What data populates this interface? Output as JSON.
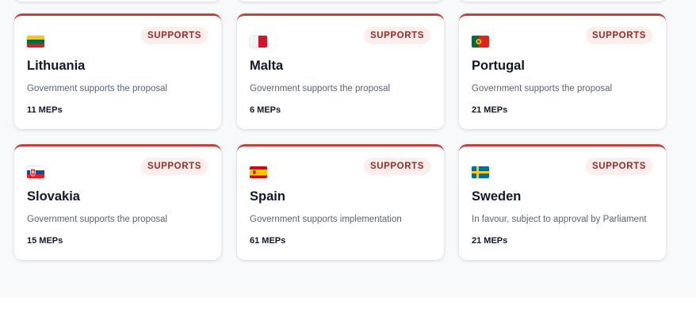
{
  "cards": [
    {
      "country": "Lithuania",
      "badge": "SUPPORTS",
      "description": "Government supports the proposal",
      "meps": "11 MEPs",
      "flag": "lithuania-flag"
    },
    {
      "country": "Malta",
      "badge": "SUPPORTS",
      "description": "Government supports the proposal",
      "meps": "6 MEPs",
      "flag": "malta-flag"
    },
    {
      "country": "Portugal",
      "badge": "SUPPORTS",
      "description": "Government supports the proposal",
      "meps": "21 MEPs",
      "flag": "portugal-flag"
    },
    {
      "country": "Slovakia",
      "badge": "SUPPORTS",
      "description": "Government supports the proposal",
      "meps": "15 MEPs",
      "flag": "slovakia-flag"
    },
    {
      "country": "Spain",
      "badge": "SUPPORTS",
      "description": "Government supports implementation",
      "meps": "61 MEPs",
      "flag": "spain-flag"
    },
    {
      "country": "Sweden",
      "badge": "SUPPORTS",
      "description": "In favour, subject to approval by Parliament",
      "meps": "21 MEPs",
      "flag": "sweden-flag"
    }
  ],
  "colors": {
    "accent": "#c0433e",
    "badge_bg": "#fceeed",
    "badge_text": "#9b2a24"
  }
}
